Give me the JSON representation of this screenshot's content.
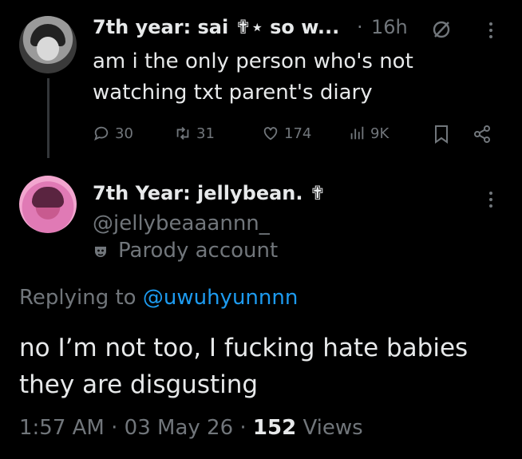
{
  "parent": {
    "display_name": "7th year: sai ✟⋆ so w...",
    "separator": "·",
    "time": "16h",
    "text_line1": "am i the only person who's not",
    "text_line2": "watching txt parent's diary",
    "metrics": {
      "replies": "30",
      "reposts": "31",
      "likes": "174",
      "views": "9K"
    }
  },
  "reply": {
    "display_name": "7th Year: jellybean. ✟",
    "handle": "@jellybeaaannn_",
    "parody_label": "Parody account",
    "replying_prefix": "Replying to",
    "replying_handle": "@uwuhyunnnn",
    "text_line1": "no I’m not too, I fucking hate babies",
    "text_line2": "they are disgusting",
    "timestamp": "1:57 AM · 03 May 26 ·",
    "views_count": "152",
    "views_label": "Views"
  },
  "colors": {
    "background": "#000000",
    "text": "#e7e9ea",
    "muted": "#71767b",
    "link": "#1d9bf0"
  }
}
